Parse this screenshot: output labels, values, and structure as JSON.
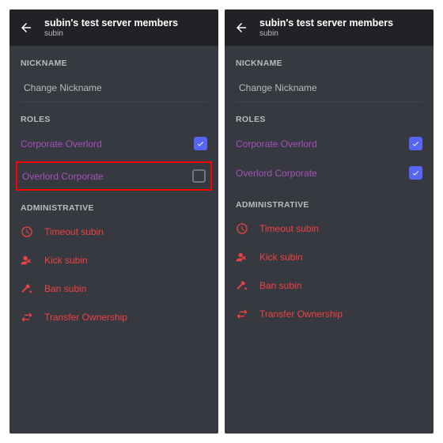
{
  "panels": [
    {
      "header": {
        "title": "subin's test server members",
        "subtitle": "subin"
      },
      "nickname": {
        "label": "NICKNAME",
        "placeholder": "Change Nickname"
      },
      "rolesLabel": "ROLES",
      "roles": [
        {
          "name": "Corporate Overlord",
          "color": "#a652bb",
          "checked": true,
          "highlight": false
        },
        {
          "name": "Overlord Corporate",
          "color": "#a652bb",
          "checked": false,
          "highlight": true
        }
      ],
      "adminLabel": "ADMINISTRATIVE",
      "admin": [
        {
          "icon": "clock",
          "label": "Timeout subin"
        },
        {
          "icon": "kick",
          "label": "Kick subin"
        },
        {
          "icon": "hammer",
          "label": "Ban subin"
        },
        {
          "icon": "transfer",
          "label": "Transfer Ownership"
        }
      ]
    },
    {
      "header": {
        "title": "subin's test server members",
        "subtitle": "subin"
      },
      "nickname": {
        "label": "NICKNAME",
        "placeholder": "Change Nickname"
      },
      "rolesLabel": "ROLES",
      "roles": [
        {
          "name": "Corporate Overlord",
          "color": "#a652bb",
          "checked": true,
          "highlight": false
        },
        {
          "name": "Overlord Corporate",
          "color": "#a652bb",
          "checked": true,
          "highlight": false
        }
      ],
      "adminLabel": "ADMINISTRATIVE",
      "admin": [
        {
          "icon": "clock",
          "label": "Timeout subin"
        },
        {
          "icon": "kick",
          "label": "Kick subin"
        },
        {
          "icon": "hammer",
          "label": "Ban subin"
        },
        {
          "icon": "transfer",
          "label": "Transfer Ownership"
        }
      ]
    }
  ]
}
